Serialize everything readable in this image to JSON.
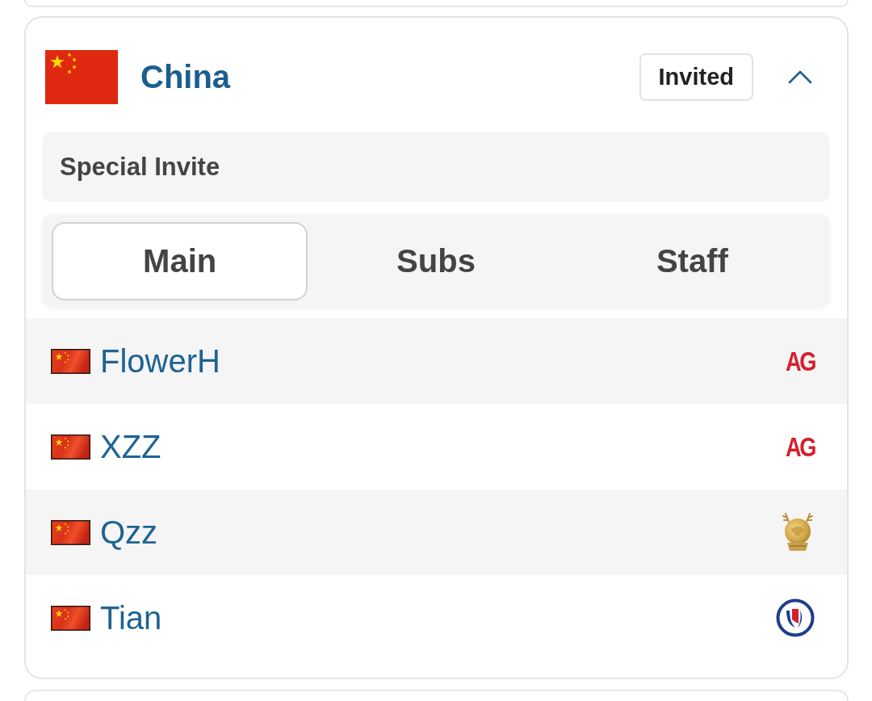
{
  "group": {
    "country": "China",
    "status": "Invited",
    "expanded": true,
    "qualification": "Special Invite",
    "tabs": [
      {
        "label": "Main",
        "selected": true
      },
      {
        "label": "Subs",
        "selected": false
      },
      {
        "label": "Staff",
        "selected": false
      }
    ],
    "players": [
      {
        "name": "FlowerH",
        "team": {
          "kind": "monogram",
          "text": "AG"
        }
      },
      {
        "name": "XZZ",
        "team": {
          "kind": "monogram",
          "text": "AG"
        }
      },
      {
        "name": "Qzz",
        "team": {
          "kind": "emblem"
        }
      },
      {
        "name": "Tian",
        "team": {
          "kind": "roundel"
        }
      }
    ]
  }
}
